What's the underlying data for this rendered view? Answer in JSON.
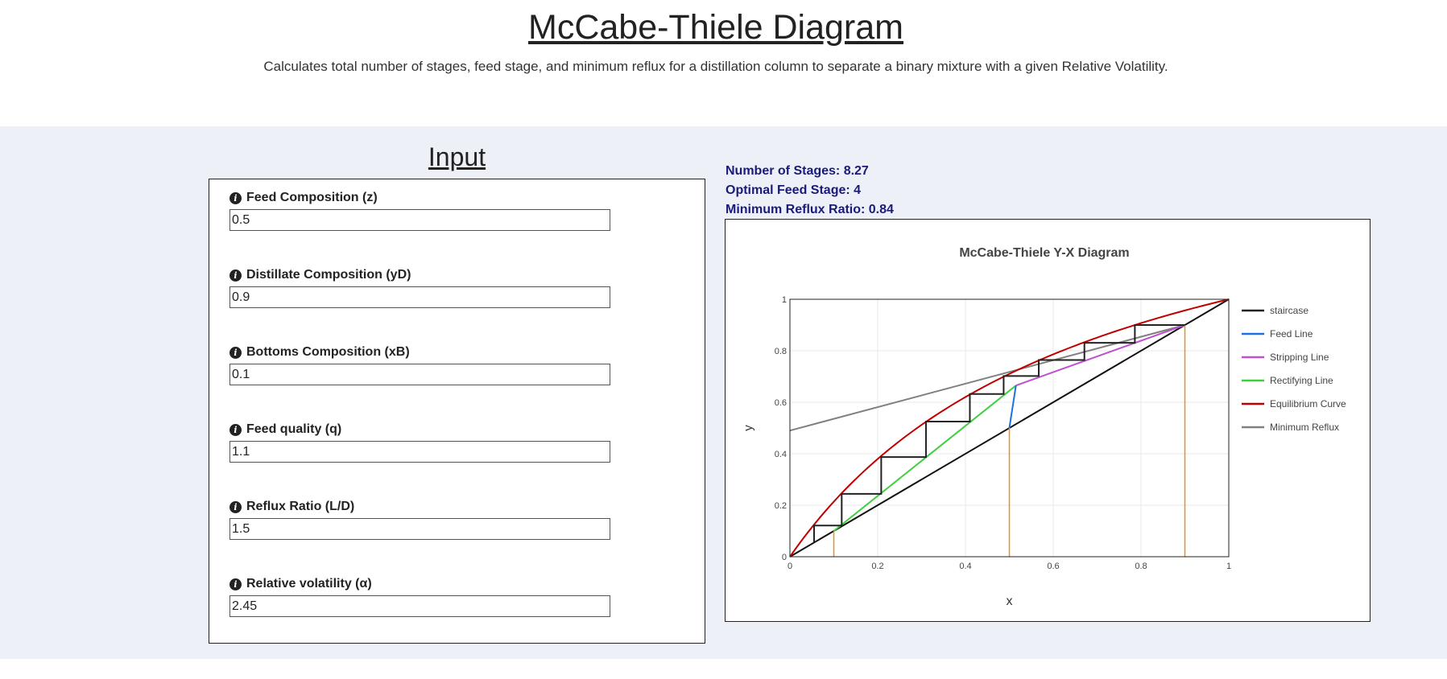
{
  "page": {
    "title": "McCabe-Thiele Diagram",
    "subtitle": "Calculates total number of stages, feed stage, and minimum reflux for a distillation column to separate a binary mixture with a given Relative Volatility."
  },
  "input": {
    "heading": "Input",
    "fields": [
      {
        "label": "Feed Composition (z)",
        "value": "0.5"
      },
      {
        "label": "Distillate Composition (yD)",
        "value": "0.9"
      },
      {
        "label": "Bottoms Composition (xB)",
        "value": "0.1"
      },
      {
        "label": "Feed quality (q)",
        "value": "1.1"
      },
      {
        "label": "Reflux Ratio (L/D)",
        "value": "1.5"
      },
      {
        "label": "Relative volatility (α)",
        "value": "2.45"
      }
    ]
  },
  "results": {
    "stages": "Number of Stages: 8.27",
    "feed_stage": "Optimal Feed Stage: 4",
    "min_reflux": "Minimum Reflux Ratio: 0.84"
  },
  "chart_data": {
    "type": "line",
    "title": "McCabe-Thiele Y-X Diagram",
    "xlabel": "x",
    "ylabel": "y",
    "xlim": [
      0,
      1
    ],
    "ylim": [
      0,
      1
    ],
    "grid": true,
    "legend_position": "right",
    "x_ticks": [
      "0",
      "0.2",
      "0.4",
      "0.6",
      "0.8",
      "1"
    ],
    "y_ticks": [
      "0",
      "0.2",
      "0.4",
      "0.6",
      "0.8",
      "1"
    ],
    "series": [
      {
        "name": "staircase",
        "color": "#222222",
        "x": [
          0.9,
          0.786,
          0.786,
          0.671,
          0.671,
          0.567,
          0.567,
          0.487,
          0.487,
          0.41,
          0.41,
          0.31,
          0.31,
          0.208,
          0.208,
          0.118,
          0.118,
          0.055,
          0.055
        ],
        "y": [
          0.9,
          0.9,
          0.831,
          0.831,
          0.764,
          0.764,
          0.702,
          0.702,
          0.632,
          0.632,
          0.525,
          0.525,
          0.387,
          0.387,
          0.244,
          0.244,
          0.121,
          0.121,
          0.057
        ]
      },
      {
        "name": "Feed Line",
        "color": "#1f6fe8",
        "x": [
          0.5,
          0.515
        ],
        "y": [
          0.5,
          0.665
        ]
      },
      {
        "name": "Stripping Line",
        "color": "#c050d0",
        "x": [
          0.515,
          0.9
        ],
        "y": [
          0.665,
          0.9
        ]
      },
      {
        "name": "Rectifying Line",
        "color": "#3ecf3e",
        "x": [
          0.1,
          0.515
        ],
        "y": [
          0.1,
          0.665
        ]
      },
      {
        "name": "Equilibrium Curve",
        "color": "#c00000",
        "equilibrium_alpha": 2.45
      },
      {
        "name": "Minimum Reflux",
        "color": "#808080",
        "x": [
          0,
          0.9
        ],
        "y": [
          0.49,
          0.9
        ]
      }
    ],
    "diagonal": {
      "color": "#111111",
      "x": [
        0,
        1
      ],
      "y": [
        0,
        1
      ]
    },
    "marker_lines": {
      "color": "#f28a1e",
      "lines": [
        {
          "x": 0.1,
          "y_top": 0.1
        },
        {
          "x": 0.5,
          "y_top": 0.5
        },
        {
          "x": 0.9,
          "y_top": 0.9
        }
      ]
    }
  }
}
